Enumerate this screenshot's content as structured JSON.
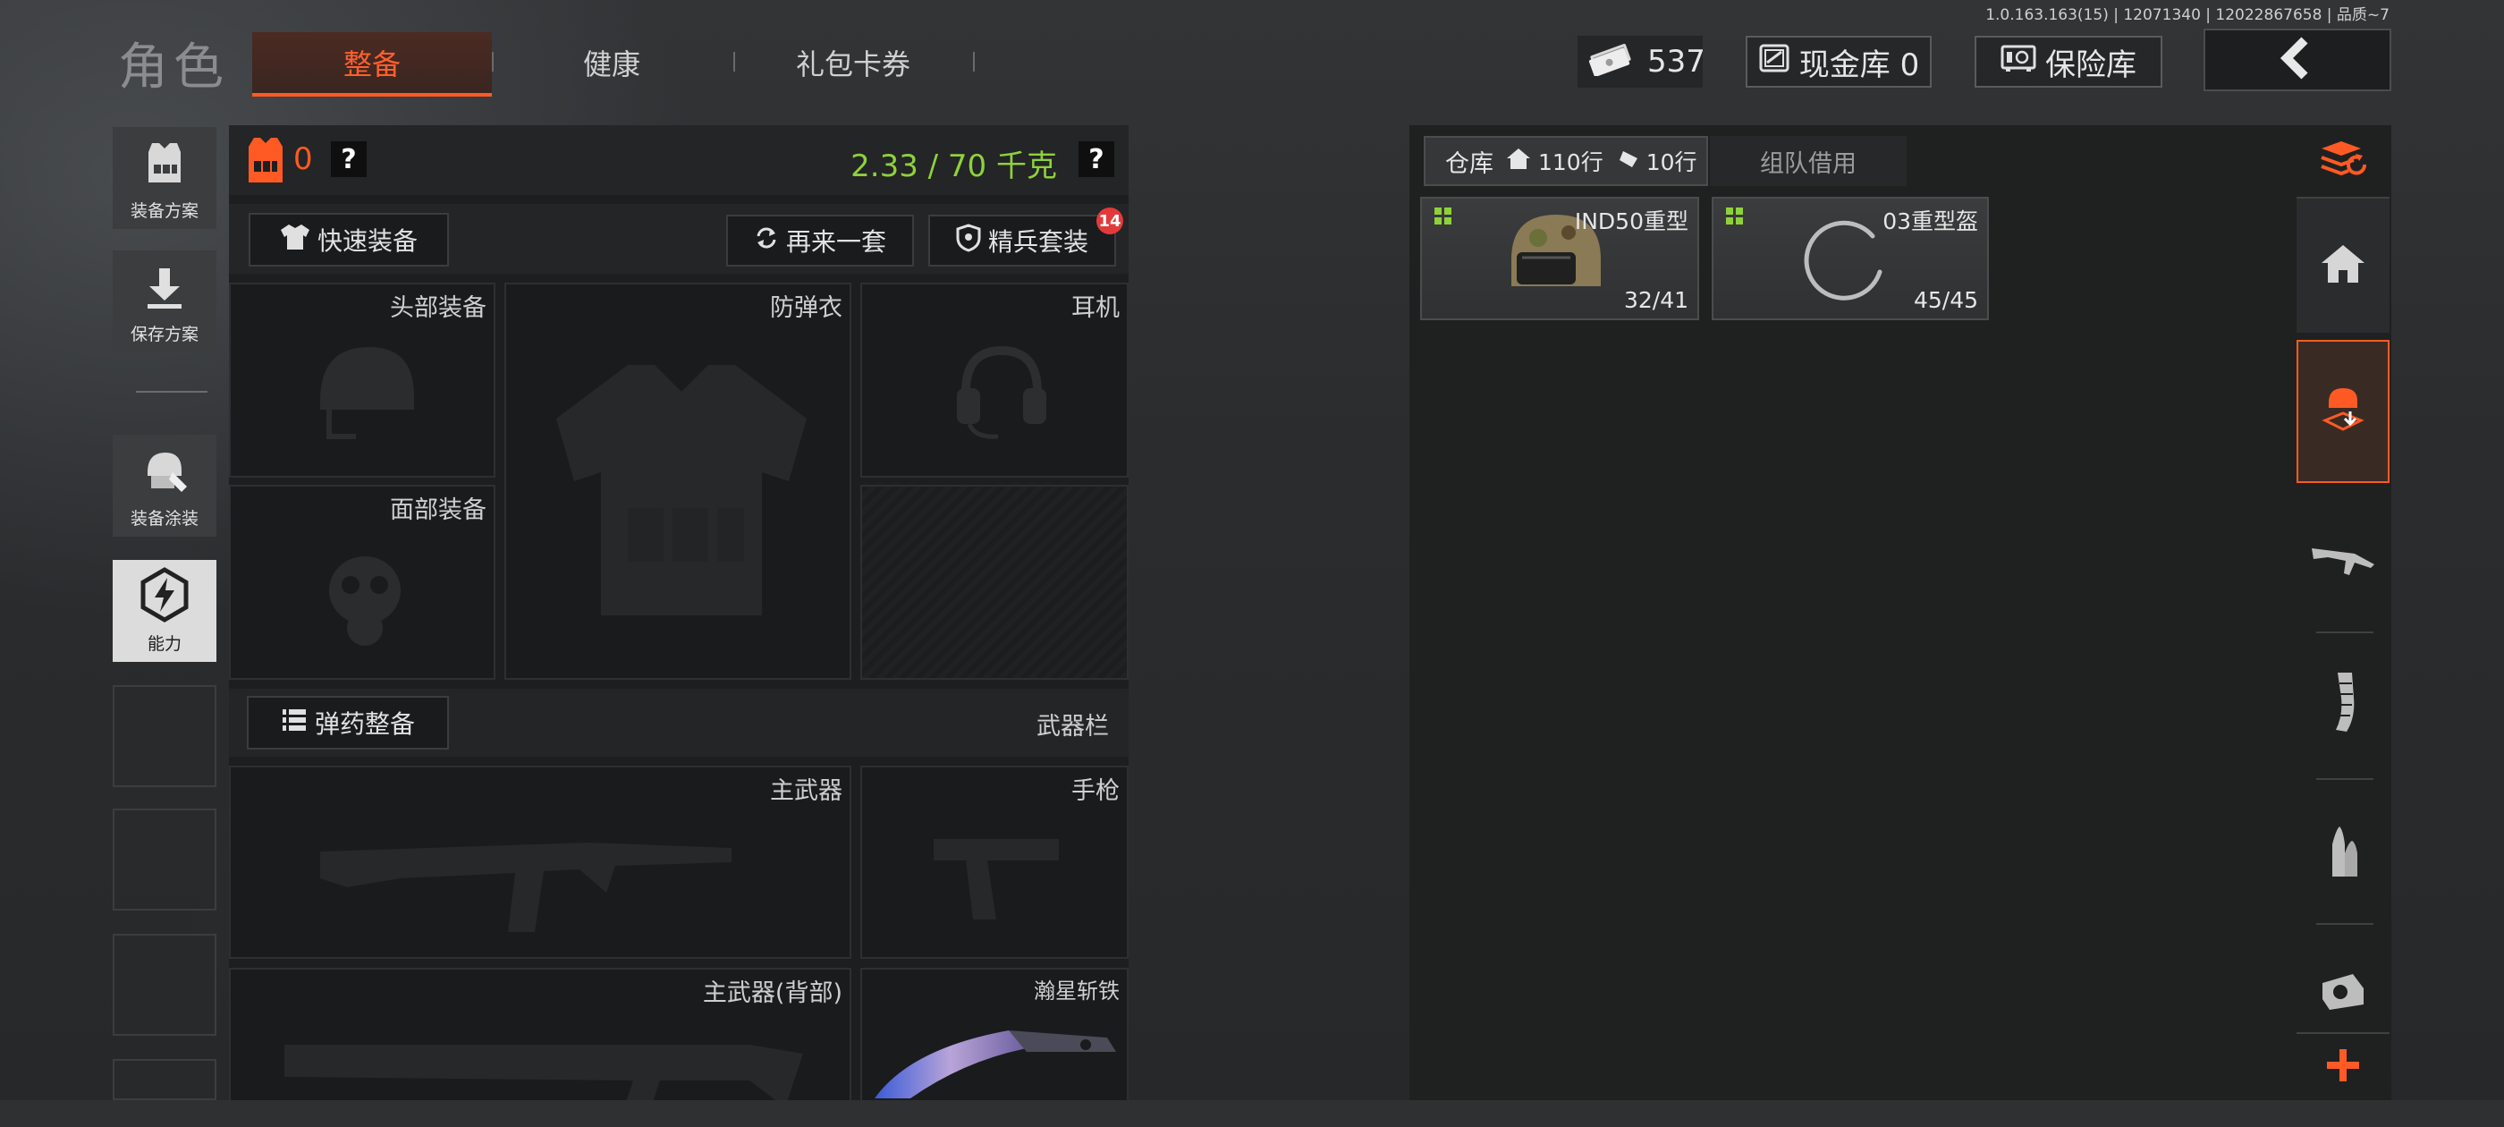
{
  "version": "1.0.163.163(15) | 12071340 | 12022867658 | 品质~7",
  "header": {
    "title": "角色",
    "tabs": [
      {
        "label": "整备",
        "active": true
      },
      {
        "label": "健康",
        "active": false
      },
      {
        "label": "礼包卡券",
        "active": false
      }
    ],
    "currency_value": "537",
    "cash_vault_label": "现金库 0",
    "safe_label": "保险库"
  },
  "side_menu": [
    {
      "label": "装备方案",
      "icon": "vest-icon"
    },
    {
      "label": "保存方案",
      "icon": "download-icon"
    },
    {
      "label": "装备涂装",
      "icon": "helmet-paint-icon"
    },
    {
      "label": "能力",
      "icon": "ability-icon"
    }
  ],
  "equipment": {
    "level_value": "0",
    "help": "?",
    "weight": "2.33 / 70 千克",
    "quick_equip": "快速装备",
    "again_set": "再来一套",
    "elite_set": "精兵套装",
    "elite_badge": "14",
    "slots": {
      "head": "头部装备",
      "armor": "防弹衣",
      "headset": "耳机",
      "face": "面部装备"
    },
    "ammo_label": "弹药整备",
    "weapon_bar": "武器栏",
    "weapons": {
      "primary": "主武器",
      "pistol": "手枪",
      "primary_back": "主武器(背部)",
      "melee": "瀚星斩铁"
    }
  },
  "storage": {
    "tab_label": "仓库",
    "rows_home": "110行",
    "rows_ticket": "10行",
    "team_tab": "组队借用",
    "items": [
      {
        "name": "IND50重型",
        "durability": "32/41"
      },
      {
        "name": "03重型盔",
        "durability": "45/45"
      }
    ]
  },
  "rail": [
    "sort-icon",
    "home-icon",
    "gear-drop-icon",
    "rifle-icon",
    "magazine-icon",
    "bullets-icon",
    "scope-icon",
    "plus-icon"
  ],
  "colors": {
    "accent": "#ff5a24",
    "weight_green": "#8fd13b",
    "badge_red": "#e23a3a"
  }
}
